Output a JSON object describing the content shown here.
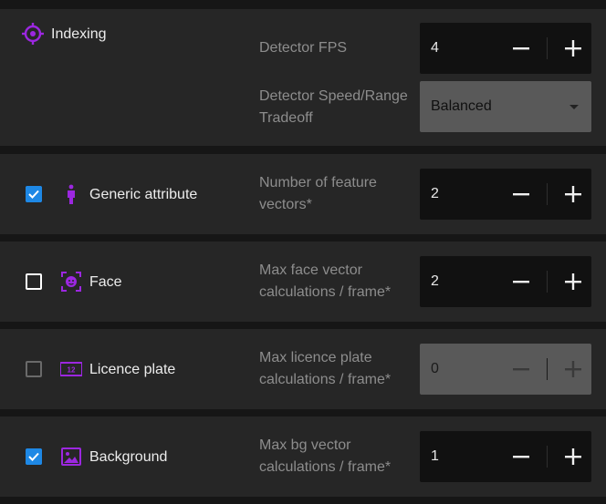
{
  "indexing": {
    "title": "Indexing",
    "fps_label": "Detector FPS",
    "fps_value": "4",
    "speed_label": "Detector Speed/Range Tradeoff",
    "speed_value": "Balanced"
  },
  "generic": {
    "label": "Generic attribute",
    "checked": true,
    "field_label": "Number of feature vectors*",
    "value": "2"
  },
  "face": {
    "label": "Face",
    "checked": false,
    "field_label": "Max face vector calculations / frame*",
    "value": "2"
  },
  "licence": {
    "label": "Licence plate",
    "checked": false,
    "disabled": true,
    "field_label": "Max licence plate calculations / frame*",
    "value": "0"
  },
  "background": {
    "label": "Background",
    "checked": true,
    "field_label": "Max bg vector calculations / frame*",
    "value": "1"
  },
  "colors": {
    "accent_purple": "#9c27e0",
    "checkbox_blue": "#1e88e5"
  }
}
